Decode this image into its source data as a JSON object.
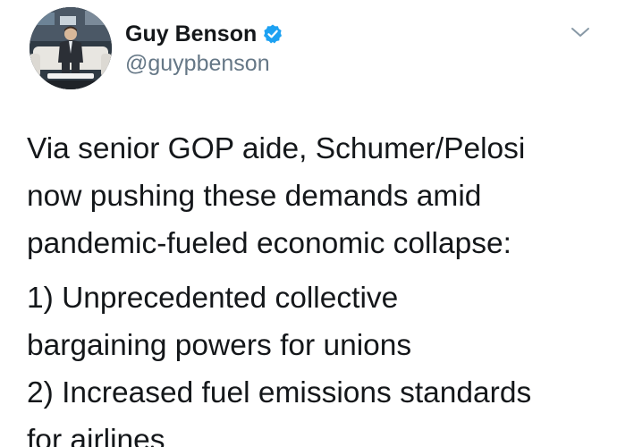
{
  "author": {
    "display_name": "Guy Benson",
    "handle": "@guypbenson",
    "verified": true,
    "verified_color": "#1da1f2"
  },
  "menu": {
    "icon": "chevron-down-icon"
  },
  "tweet": {
    "paragraphs": [
      {
        "lines": [
          "Via senior GOP aide, Schumer/Pelosi",
          "now pushing these demands amid",
          "pandemic-fueled economic collapse:"
        ]
      },
      {
        "lines": [
          "1) Unprecedented collective",
          "bargaining powers for unions",
          "2) Increased fuel emissions standards",
          "for airlines"
        ]
      }
    ]
  }
}
